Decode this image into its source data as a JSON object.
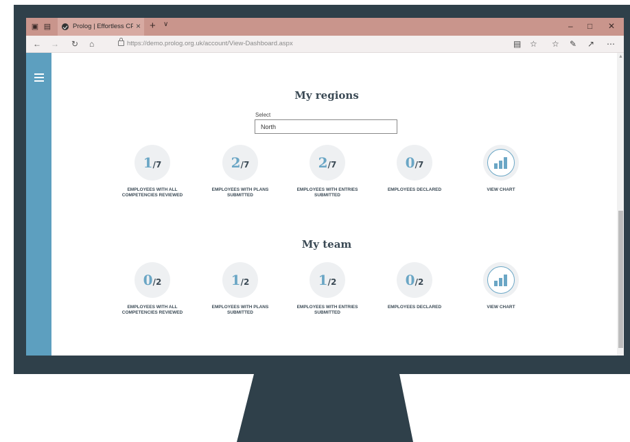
{
  "browser": {
    "tab_title": "Prolog | Effortless CPD c",
    "url_host": "https://demo.prolog.org.uk",
    "url_path": "/account/View-Dashboard.aspx"
  },
  "regions": {
    "title": "My regions",
    "select_label": "Select",
    "select_value": "North",
    "stats": [
      {
        "num": "1",
        "den": "/7",
        "label": "EMPLOYEES WITH ALL COMPETENCIES REVIEWED"
      },
      {
        "num": "2",
        "den": "/7",
        "label": "EMPLOYEES WITH PLANS SUBMITTED"
      },
      {
        "num": "2",
        "den": "/7",
        "label": "EMPLOYEES WITH ENTRIES SUBMITTED"
      },
      {
        "num": "0",
        "den": "/7",
        "label": "EMPLOYEES DECLARED"
      }
    ],
    "chart_label": "VIEW CHART"
  },
  "team": {
    "title": "My team",
    "stats": [
      {
        "num": "0",
        "den": "/2",
        "label": "EMPLOYEES WITH ALL COMPETENCIES REVIEWED"
      },
      {
        "num": "1",
        "den": "/2",
        "label": "EMPLOYEES WITH PLANS SUBMITTED"
      },
      {
        "num": "1",
        "den": "/2",
        "label": "EMPLOYEES WITH ENTRIES SUBMITTED"
      },
      {
        "num": "0",
        "den": "/2",
        "label": "EMPLOYEES DECLARED"
      }
    ],
    "chart_label": "VIEW CHART"
  },
  "colors": {
    "accent": "#6aa6c5",
    "sidebar": "#5d9fbf",
    "bezel": "#2f404a",
    "titlebar": "#c9958c"
  },
  "icons": [
    "tab-preview-icon",
    "back-icon",
    "forward-icon",
    "refresh-icon",
    "home-icon",
    "lock-icon",
    "reading-view-icon",
    "favorite-icon",
    "favorites-list-icon",
    "pen-icon",
    "share-icon",
    "more-icon",
    "hamburger-icon",
    "bar-chart-icon"
  ]
}
